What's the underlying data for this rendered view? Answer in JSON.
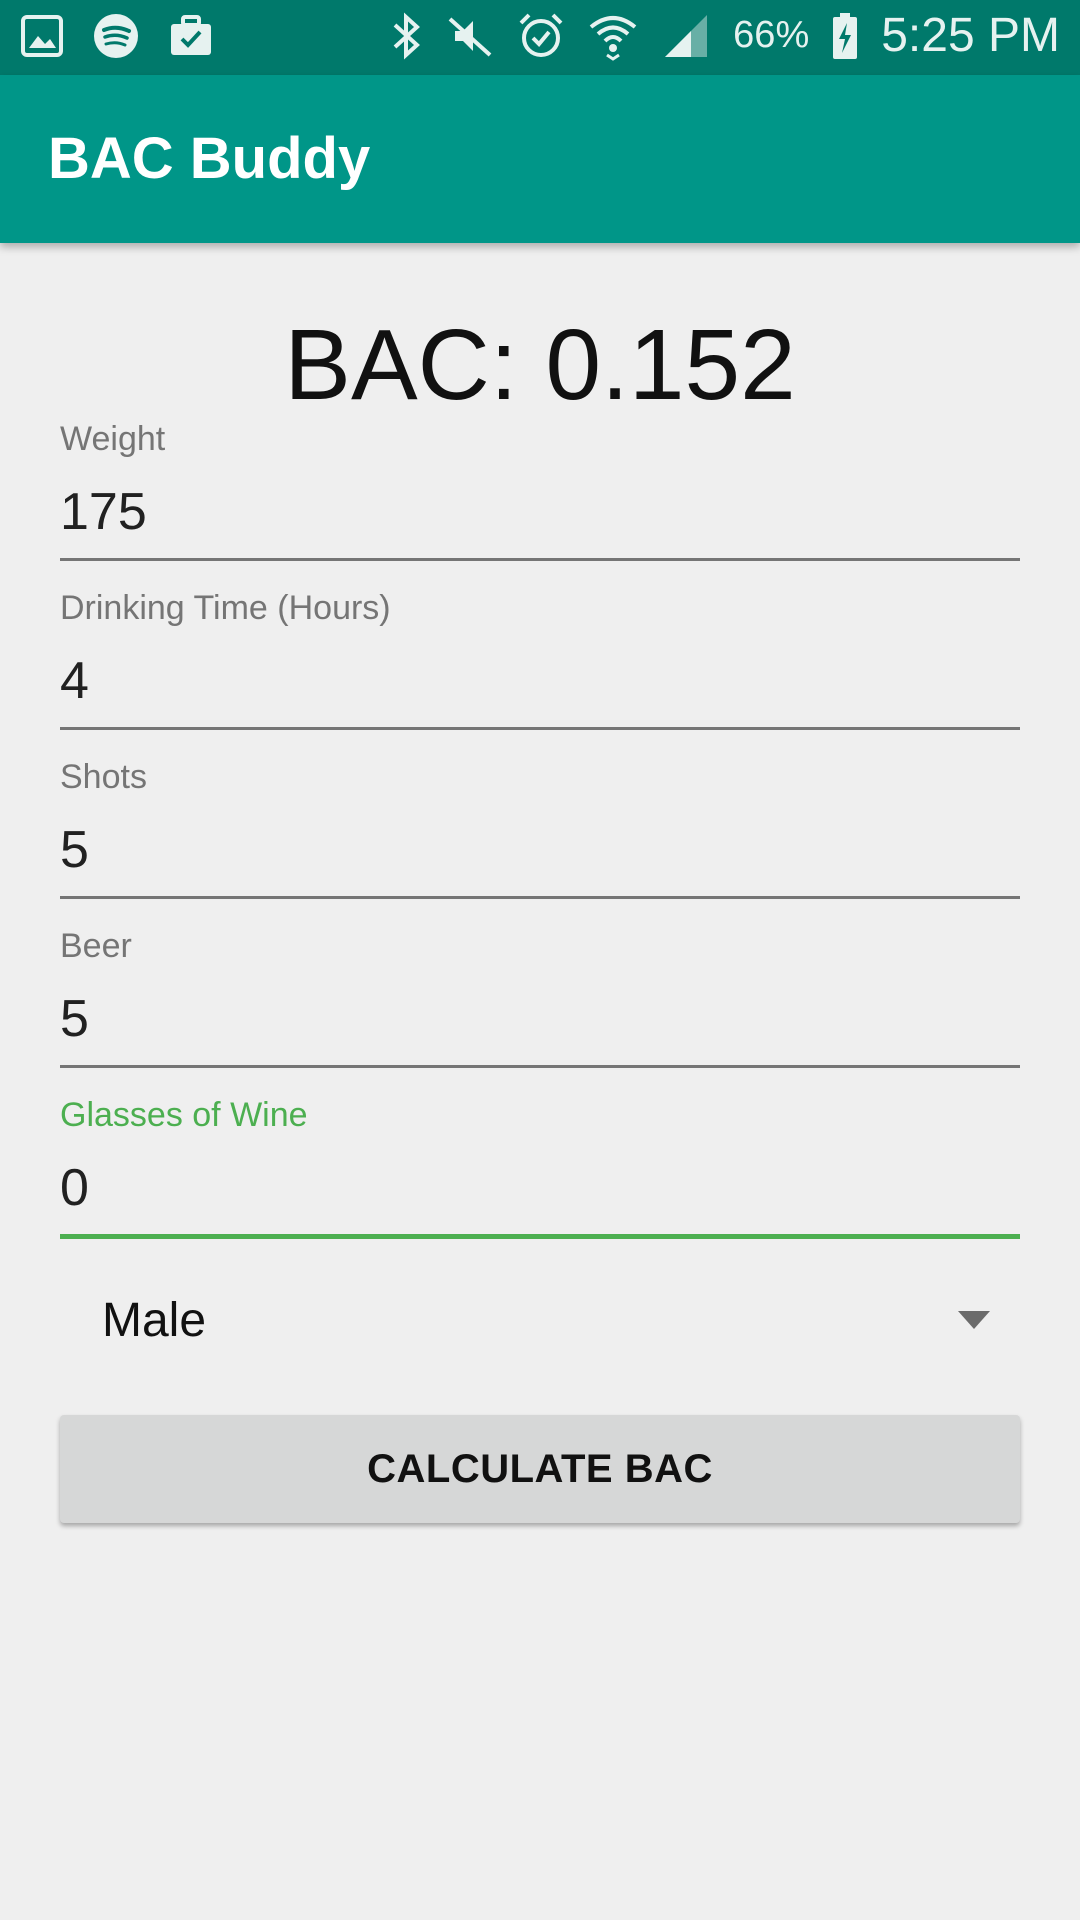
{
  "status_bar": {
    "left_icons": [
      "image-icon",
      "spotify-icon",
      "briefcase-check-icon"
    ],
    "right_icons": [
      "bluetooth-icon",
      "vibrate-off-icon",
      "alarm-icon",
      "wifi-icon",
      "signal-icon",
      "battery-charging-icon"
    ],
    "battery_percent": "66%",
    "time": "5:25 PM"
  },
  "app_bar": {
    "title": "BAC Buddy",
    "color": "#009688"
  },
  "result": {
    "text": "BAC: 0.152"
  },
  "fields": [
    {
      "label": "Weight",
      "value": "175"
    },
    {
      "label": "Drinking Time (Hours)",
      "value": "4"
    },
    {
      "label": "Shots",
      "value": "5"
    },
    {
      "label": "Beer",
      "value": "5"
    },
    {
      "label": "Glasses of Wine",
      "value": "0",
      "focused": true
    }
  ],
  "gender_spinner": {
    "selected": "Male"
  },
  "calculate_button": {
    "label": "CALCULATE BAC"
  },
  "colors": {
    "status_bar": "#00796b",
    "accent": "#4caf50",
    "background": "#efefef"
  }
}
